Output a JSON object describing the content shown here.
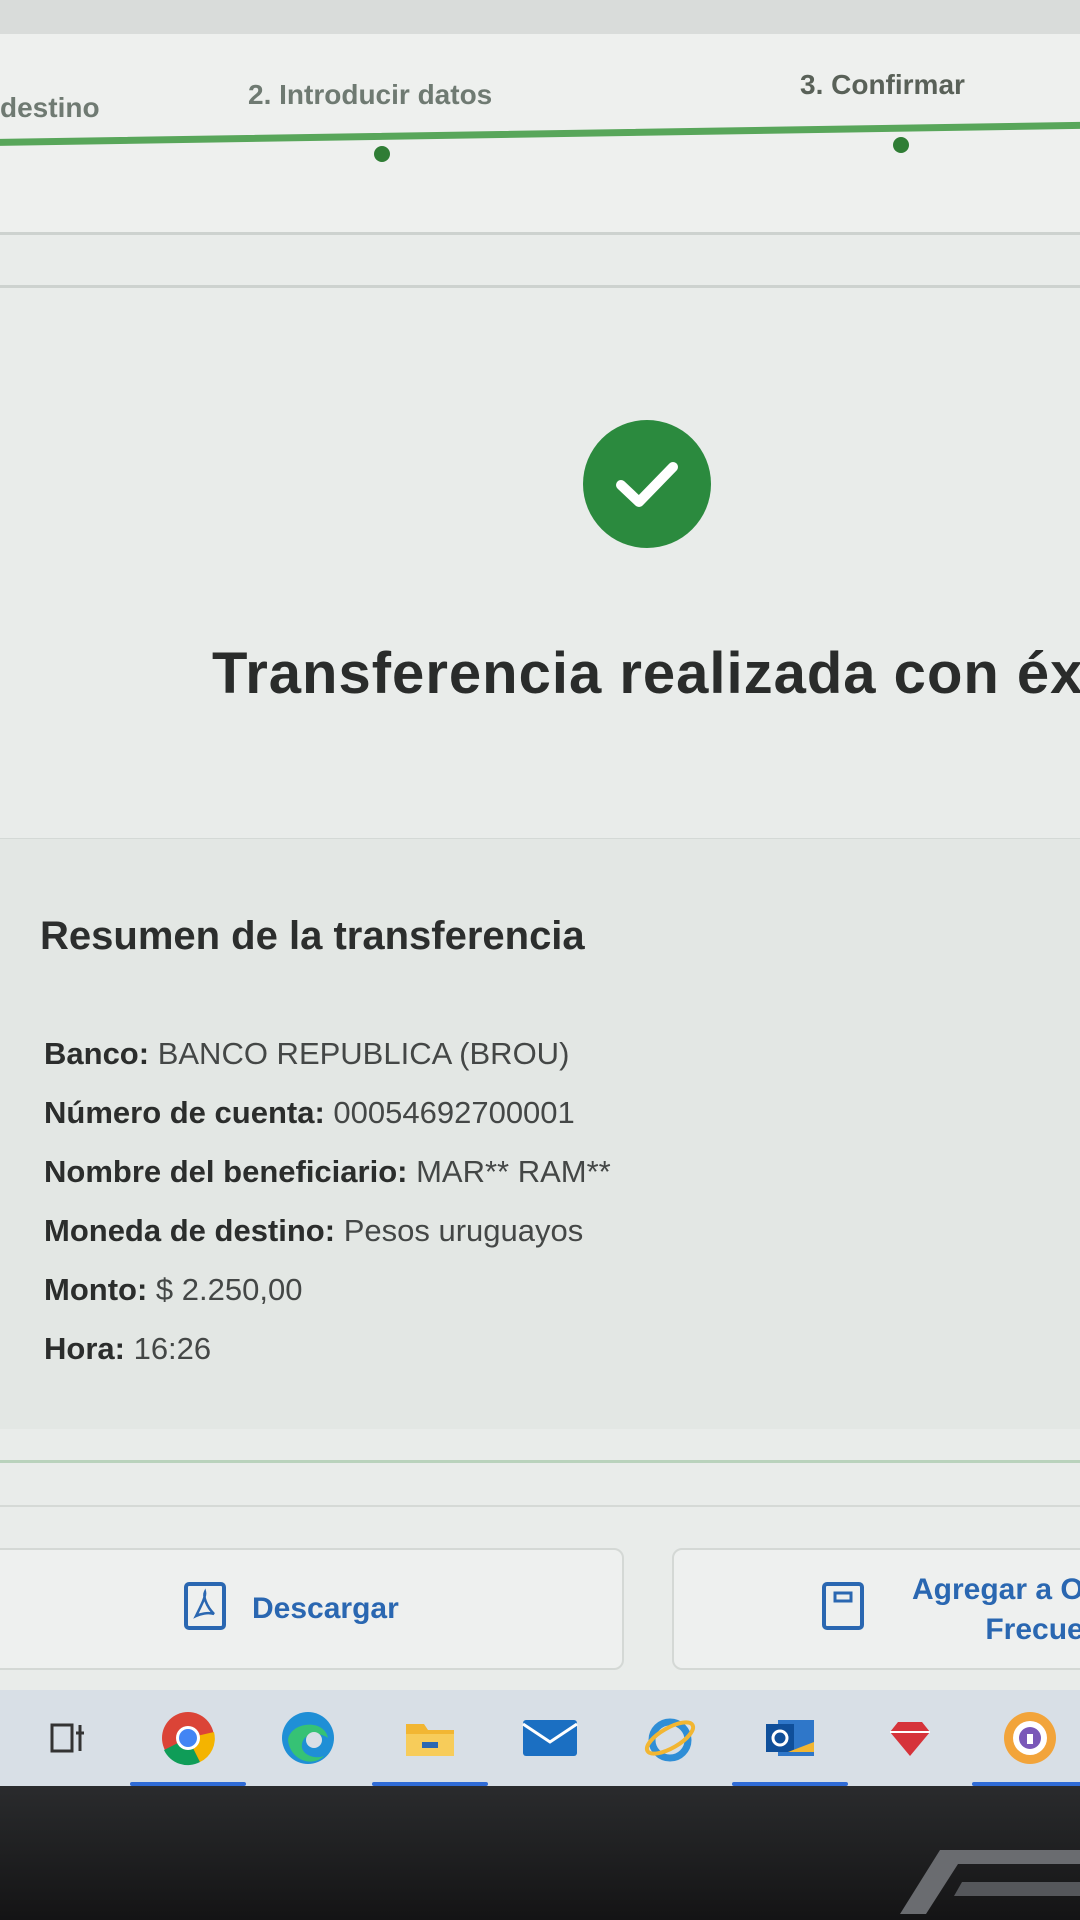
{
  "stepper": {
    "steps": [
      {
        "label": "destino"
      },
      {
        "label": "2. Introducir datos"
      },
      {
        "label": "3. Confirmar"
      }
    ]
  },
  "success": {
    "icon": "check-icon",
    "title": "Transferencia realizada con éxito"
  },
  "summary": {
    "title": "Resumen de la transferencia",
    "rows": [
      {
        "key": "Banco:",
        "value": "BANCO REPUBLICA (BROU)"
      },
      {
        "key": "Número de cuenta:",
        "value": "00054692700001"
      },
      {
        "key": "Nombre del beneficiario:",
        "value": "MAR** RAM**"
      },
      {
        "key": "Moneda de destino:",
        "value": "Pesos uruguayos"
      },
      {
        "key": "Monto:",
        "value": "$ 2.250,00"
      },
      {
        "key": "Hora:",
        "value": "16:26"
      }
    ]
  },
  "actions": {
    "download_label": "Descargar",
    "frequent_label_line1": "Agregar a O",
    "frequent_label_line2": "Frecue"
  },
  "taskbar": {
    "items": [
      "task-view-icon",
      "chrome-icon",
      "edge-icon",
      "file-explorer-icon",
      "mail-icon",
      "internet-explorer-icon",
      "outlook-icon",
      "gem-icon",
      "vpn-icon"
    ]
  },
  "colors": {
    "accent_green": "#2b8a3e",
    "link_blue": "#2a67b1",
    "stepper_green": "#58a65a"
  }
}
